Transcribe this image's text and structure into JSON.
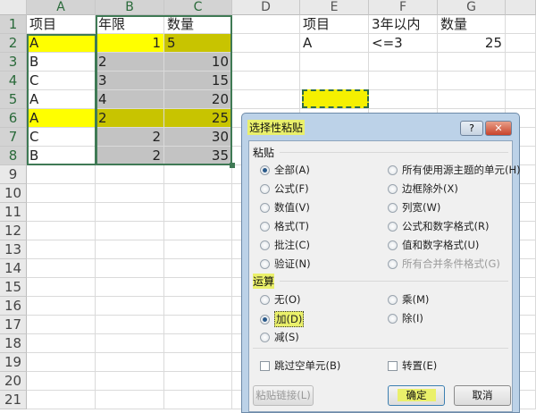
{
  "columns": [
    "A",
    "B",
    "C",
    "D",
    "E",
    "F",
    "G"
  ],
  "rows": [
    "1",
    "2",
    "3",
    "4",
    "5",
    "6",
    "7",
    "8",
    "9",
    "10",
    "11",
    "12",
    "13",
    "14",
    "15",
    "16",
    "17",
    "18",
    "19",
    "20",
    "21"
  ],
  "cells": [
    [
      {
        "v": "项目"
      },
      {
        "v": "年限"
      },
      {
        "v": "数量"
      },
      {
        "v": ""
      },
      {
        "v": "项目"
      },
      {
        "v": "3年以内"
      },
      {
        "v": "数量"
      }
    ],
    [
      {
        "v": "A",
        "f": "yellow"
      },
      {
        "v": "1",
        "f": "yellow",
        "r": 1
      },
      {
        "v": "5",
        "f": "olive"
      },
      {
        "v": ""
      },
      {
        "v": "A"
      },
      {
        "v": "<=3"
      },
      {
        "v": "25",
        "r": 1
      }
    ],
    [
      {
        "v": "B"
      },
      {
        "v": "2",
        "f": "gray"
      },
      {
        "v": "10",
        "f": "gray",
        "r": 1
      }
    ],
    [
      {
        "v": "C"
      },
      {
        "v": "3",
        "f": "gray"
      },
      {
        "v": "15",
        "f": "gray",
        "r": 1
      }
    ],
    [
      {
        "v": "A"
      },
      {
        "v": "4",
        "f": "gray"
      },
      {
        "v": "20",
        "f": "gray",
        "r": 1
      }
    ],
    [
      {
        "v": "A",
        "f": "yellow"
      },
      {
        "v": "2",
        "f": "olive"
      },
      {
        "v": "25",
        "f": "olive",
        "r": 1
      }
    ],
    [
      {
        "v": "C"
      },
      {
        "v": "2",
        "f": "gray",
        "r": 1
      },
      {
        "v": "30",
        "f": "gray",
        "r": 1
      }
    ],
    [
      {
        "v": "B"
      },
      {
        "v": "2",
        "f": "gray",
        "r": 1
      },
      {
        "v": "35",
        "f": "gray",
        "r": 1
      }
    ]
  ],
  "fills": {
    "yellow": "#ffff00",
    "olive": "#c8c400",
    "gray": "#c3c3c3"
  },
  "dialog": {
    "title": "选择性粘贴",
    "help": "?",
    "close": "✕",
    "paste_label": "粘贴",
    "paste_options_left": [
      "全部(A)",
      "公式(F)",
      "数值(V)",
      "格式(T)",
      "批注(C)",
      "验证(N)"
    ],
    "paste_options_right": [
      "所有使用源主题的单元(H)",
      "边框除外(X)",
      "列宽(W)",
      "公式和数字格式(R)",
      "值和数字格式(U)",
      "所有合并条件格式(G)"
    ],
    "operation_label": "运算",
    "operation_left": [
      "无(O)",
      "加(D)",
      "减(S)"
    ],
    "operation_right": [
      "乘(M)",
      "除(I)"
    ],
    "skip_blanks": "跳过空单元(B)",
    "transpose": "转置(E)",
    "paste_link": "粘贴链接(L)",
    "ok": "确定",
    "cancel": "取消"
  }
}
